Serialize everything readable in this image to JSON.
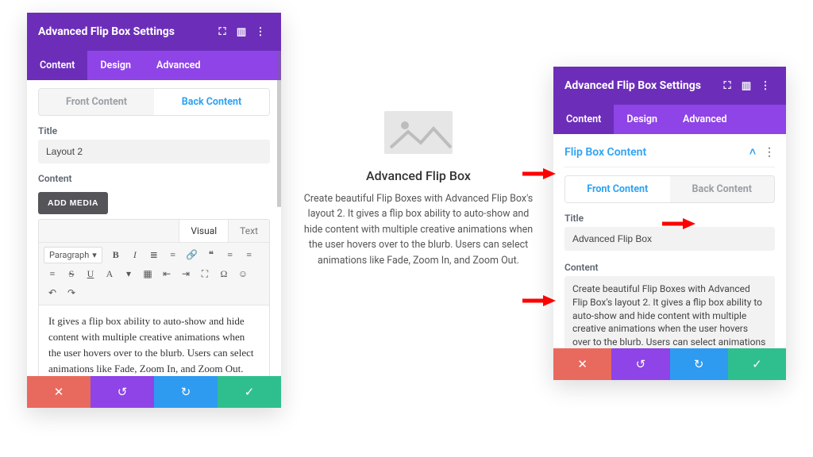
{
  "colors": {
    "purpleDark": "#6c2eb9",
    "purpleLight": "#8e44e6",
    "blue": "#2e9bf0",
    "green": "#2fbf8f",
    "red": "#e86a5e",
    "accentText": "#2ea3f2"
  },
  "left": {
    "title": "Advanced Flip Box Settings",
    "tabs": {
      "content": "Content",
      "design": "Design",
      "advanced": "Advanced"
    },
    "activeTab": "content",
    "seg": {
      "front": "Front Content",
      "back": "Back Content",
      "active": "back"
    },
    "title_label": "Title",
    "title_value": "Layout 2",
    "content_label": "Content",
    "add_media": "ADD MEDIA",
    "editor_tabs": {
      "visual": "Visual",
      "text": "Text"
    },
    "para_label": "Paragraph",
    "editor_body": "It gives a flip box ability to auto-show and hide content with multiple creative animations when the user hovers over to the blurb. Users can select animations like Fade, Zoom In, and Zoom Out."
  },
  "preview": {
    "heading": "Advanced Flip Box",
    "body": "Create beautiful Flip Boxes with Advanced Flip Box's layout 2. It gives a flip box ability to auto-show and hide content with multiple creative animations when the user hovers over to the blurb. Users can select animations like Fade, Zoom In, and Zoom Out."
  },
  "right": {
    "title": "Advanced Flip Box Settings",
    "tabs": {
      "content": "Content",
      "design": "Design",
      "advanced": "Advanced"
    },
    "section_title": "Flip Box Content",
    "seg": {
      "front": "Front Content",
      "back": "Back Content",
      "active": "front"
    },
    "title_label": "Title",
    "title_value": "Advanced Flip Box",
    "content_label": "Content",
    "content_value": "Create beautiful Flip Boxes with Advanced Flip Box's layout 2. It gives a flip box ability to auto-show and hide content with multiple creative animations when the user hovers over to the blurb. Users can select animations like Fade, Zoom In, and Zoom Out."
  },
  "actions": {
    "cancel": "✕",
    "undo": "↺",
    "redo": "↻",
    "save": "✓"
  }
}
